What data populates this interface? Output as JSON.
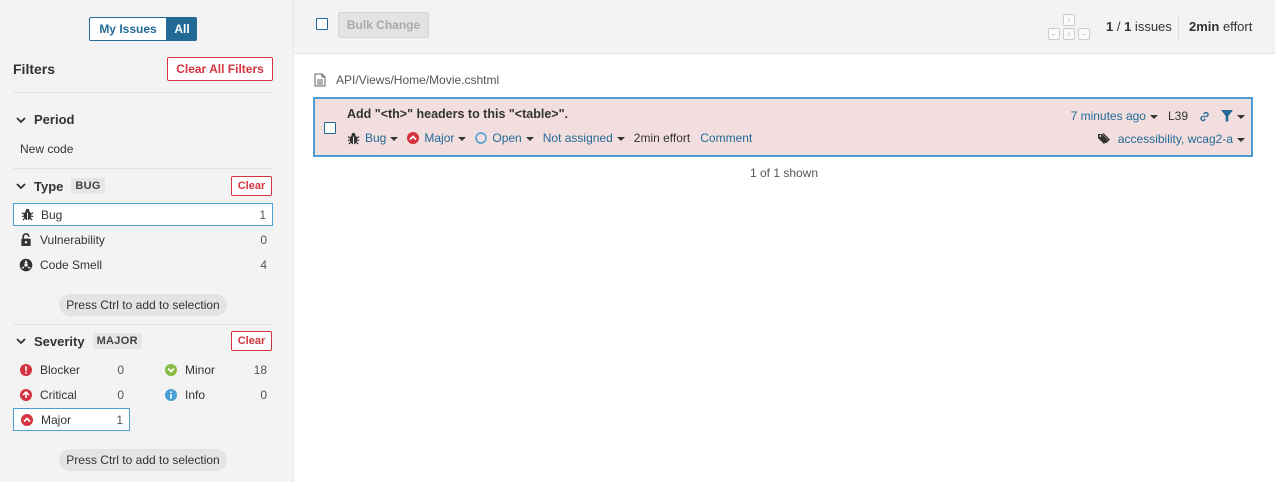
{
  "toggle": {
    "my_issues": "My Issues",
    "all": "All"
  },
  "filters": {
    "title": "Filters",
    "clear_all": "Clear All Filters"
  },
  "period": {
    "title": "Period",
    "value": "New code"
  },
  "type": {
    "title": "Type",
    "badge": "BUG",
    "clear": "Clear",
    "items": [
      {
        "label": "Bug",
        "count": "1",
        "icon": "bug-icon"
      },
      {
        "label": "Vulnerability",
        "count": "0",
        "icon": "lock-icon"
      },
      {
        "label": "Code Smell",
        "count": "4",
        "icon": "code-smell-icon"
      }
    ],
    "hint": "Press Ctrl to add to selection"
  },
  "severity": {
    "title": "Severity",
    "badge": "MAJOR",
    "clear": "Clear",
    "items": [
      {
        "label": "Blocker",
        "count": "0"
      },
      {
        "label": "Critical",
        "count": "0"
      },
      {
        "label": "Major",
        "count": "1"
      },
      {
        "label": "Minor",
        "count": "18"
      },
      {
        "label": "Info",
        "count": "0"
      }
    ],
    "hint": "Press Ctrl to add to selection"
  },
  "toolbar": {
    "bulk_change": "Bulk Change",
    "count_current": "1",
    "count_sep": " / ",
    "count_total": "1",
    "count_suffix": " issues",
    "effort_value": "2min",
    "effort_suffix": " effort",
    "keys": [
      "↑",
      "←",
      "↓",
      "→"
    ]
  },
  "issue": {
    "file": "API/Views/Home/Movie.cshtml",
    "title": "Add \"<th>\" headers to this \"<table>\".",
    "type": "Bug",
    "severity": "Major",
    "status": "Open",
    "assignee": "Not assigned",
    "effort": "2min effort",
    "comment": "Comment",
    "time": "7 minutes ago",
    "line": "L39",
    "tags": "accessibility, wcag2-a"
  },
  "shown": "1 of 1 shown",
  "colors": {
    "accent": "#236a97",
    "danger": "#d4333f",
    "issue_bg": "#f2dede",
    "selected_border": "#4b9fd5"
  }
}
